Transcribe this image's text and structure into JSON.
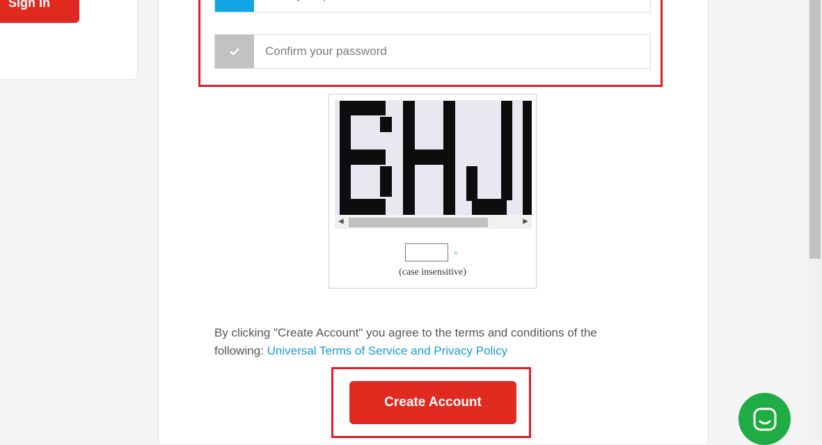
{
  "header": {
    "signin_label": "Sign In"
  },
  "form": {
    "password_placeholder": "Enter your password",
    "confirm_placeholder": "Confirm your password"
  },
  "captcha": {
    "text": "BHJ",
    "required_mark": "*",
    "note": "(case insensitive)"
  },
  "terms": {
    "text": "By clicking \"Create Account\" you agree to the terms and conditions of the following: ",
    "link_label": "Universal Terms of Service and Privacy Policy"
  },
  "actions": {
    "create_label": "Create Account"
  },
  "icons": {
    "password_icon": "lock-icon",
    "confirm_icon": "check-icon",
    "chat_icon": "chat-icon"
  },
  "colors": {
    "brand_red": "#e02a20",
    "highlight_red": "#e01b24",
    "accent_blue": "#12a5e6",
    "link_blue": "#1a9bd7",
    "chat_green": "#1fac44"
  }
}
